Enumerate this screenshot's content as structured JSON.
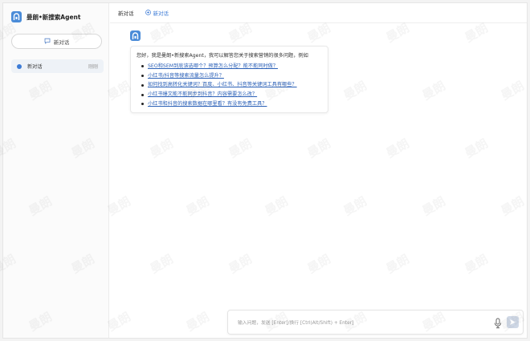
{
  "sidebar": {
    "brand_title": "曼朗•新搜索Agent",
    "new_chat_label": "新对话",
    "conversations": [
      {
        "label": "新对话",
        "time": "刚刚"
      }
    ]
  },
  "header": {
    "breadcrumb": "新对话",
    "new_tab_label": "新对话"
  },
  "message": {
    "intro": "您好，我是曼朗•新搜索Agent，我可以解答您关于搜索营销的很多问题，例如",
    "suggestions": [
      "SEO和SEM到底该选哪个？预算怎么分配？能不能同时做？",
      "小红书/抖音等搜索流量怎么提升？",
      "如何找到高转化关键词？百度、小红书、抖音等关键词工具有哪些？",
      "小红书爆文能不能同步到抖音？内容需要怎么改？",
      "小红书和抖音的搜索数据在哪里看？有没有免费工具？"
    ]
  },
  "input": {
    "placeholder": "输入问题，发送 [Enter]/换行 [Ctrl(Alt/Shift) + Enter]",
    "value": ""
  },
  "watermark": {
    "text": "曼朗"
  },
  "colors": {
    "accent": "#3c7bd6",
    "logo": "#4b8cd8",
    "link": "#2d62b8"
  },
  "icons": [
    "logo-icon",
    "chat-bubble-icon",
    "mic-icon",
    "send-icon"
  ]
}
